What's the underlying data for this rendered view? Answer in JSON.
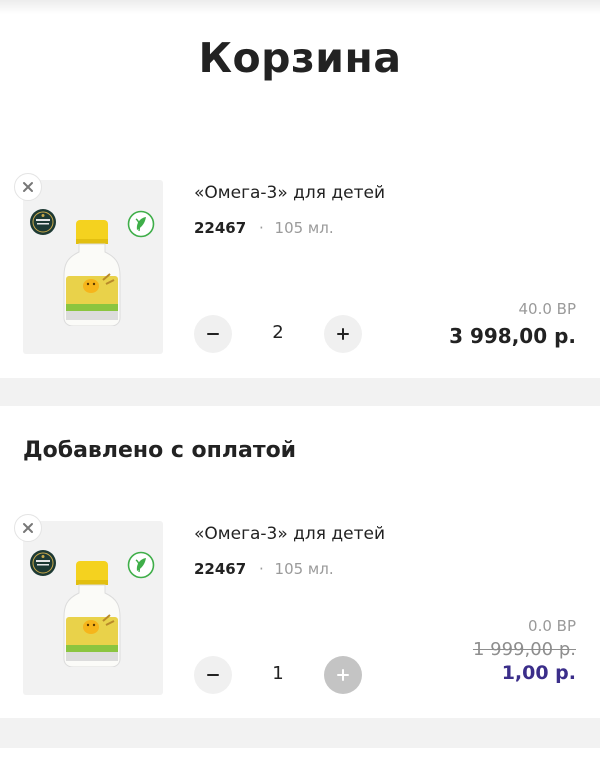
{
  "header": {
    "title": "Корзина"
  },
  "cart": {
    "items": [
      {
        "name": "«Омега-3» для детей",
        "code": "22467",
        "separator": "·",
        "volume": "105 мл.",
        "quantity": "2",
        "bp": "40.0 BP",
        "price": "3 998,00 р."
      }
    ]
  },
  "paid_section": {
    "title": "Добавлено с оплатой",
    "items": [
      {
        "name": "«Омега-3» для детей",
        "code": "22467",
        "separator": "·",
        "volume": "105 мл.",
        "quantity": "1",
        "bp": "0.0 BP",
        "old_price": "1 999,00 р.",
        "price": "1,00 р.",
        "plus_disabled": true
      }
    ]
  },
  "colors": {
    "accent_price": "#3b2e8a",
    "band_gray": "#f2f2f2",
    "disabled_button": "#c4c4c4",
    "cap_yellow": "#f4d21f",
    "bottle_green": "#8bc53f"
  },
  "icons": [
    "close-icon",
    "minus-icon",
    "plus-icon",
    "award-badge-icon",
    "green-leaf-badge-icon",
    "product-bottle-image"
  ]
}
